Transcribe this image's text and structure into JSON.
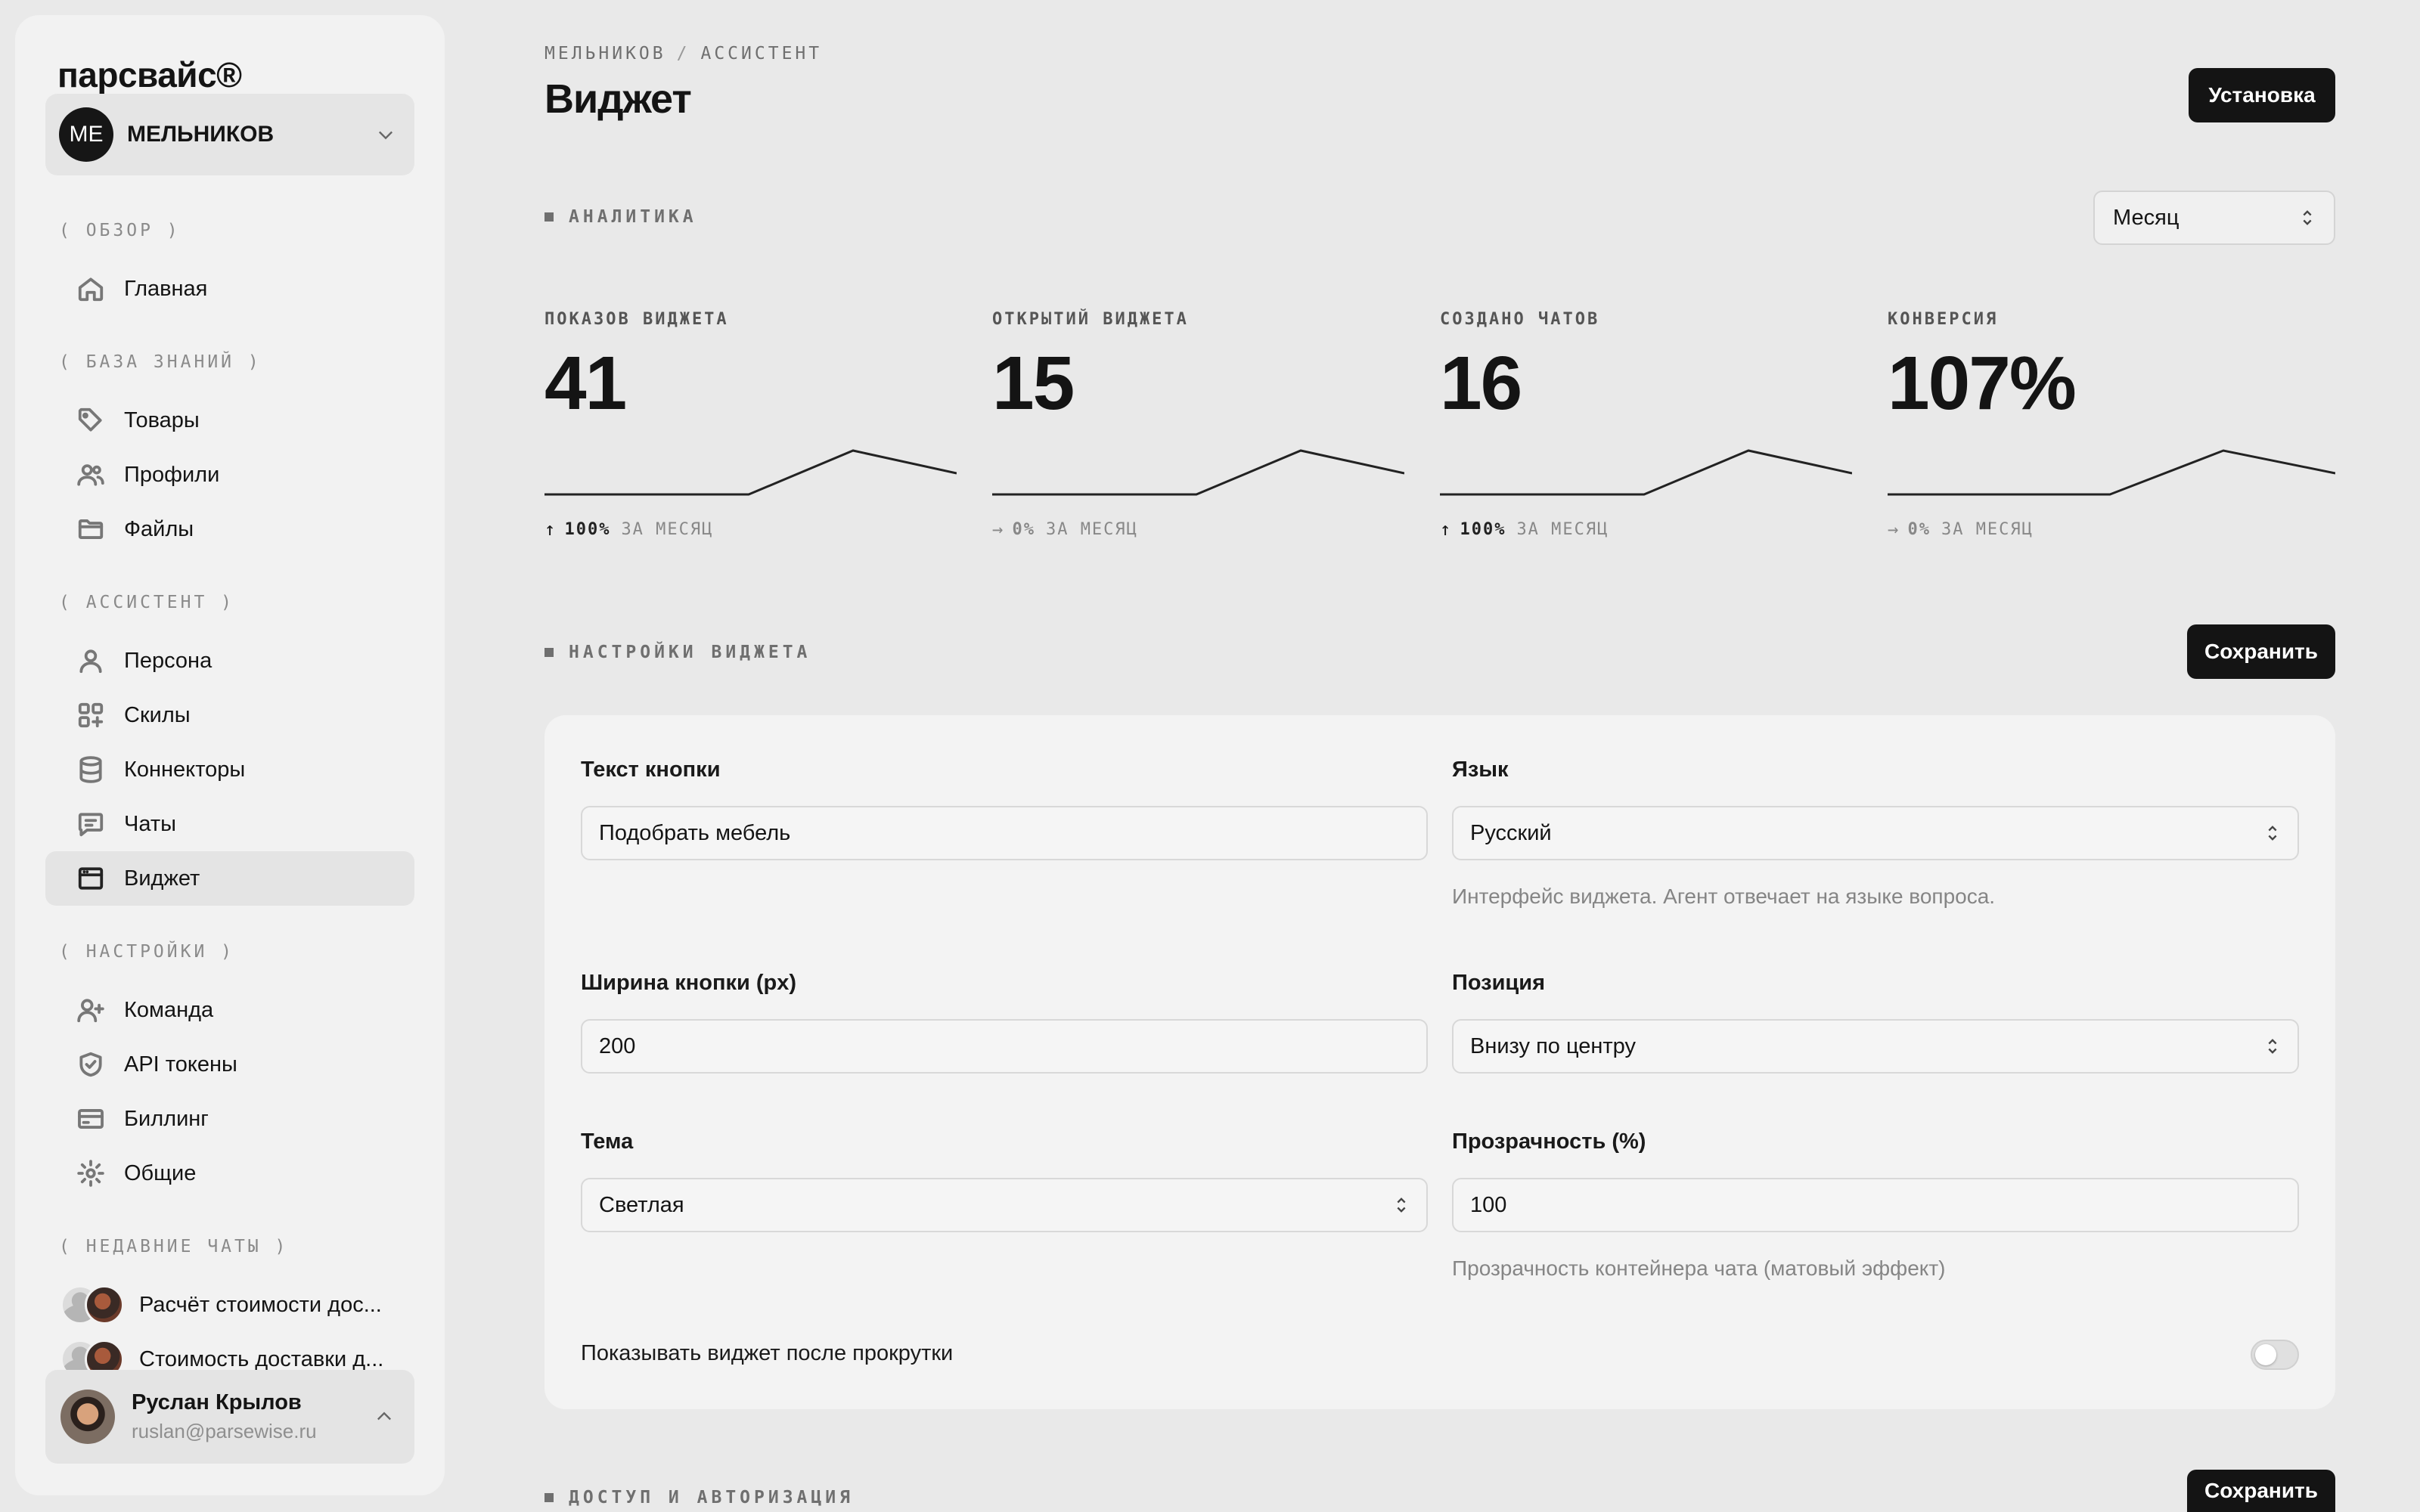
{
  "app": {
    "logo": "парсвайс®"
  },
  "org": {
    "initials": "МЕ",
    "name": "МЕЛЬНИКОВ"
  },
  "sidebar": {
    "sections": [
      {
        "label": "( ОБЗОР )",
        "items": [
          {
            "label": "Главная",
            "icon": "home-icon"
          }
        ]
      },
      {
        "label": "( БАЗА ЗНАНИЙ )",
        "items": [
          {
            "label": "Товары",
            "icon": "tag-icon"
          },
          {
            "label": "Профили",
            "icon": "users-icon"
          },
          {
            "label": "Файлы",
            "icon": "folder-icon"
          }
        ]
      },
      {
        "label": "( АССИСТЕНТ )",
        "items": [
          {
            "label": "Персона",
            "icon": "user-icon"
          },
          {
            "label": "Скилы",
            "icon": "grid-plus-icon"
          },
          {
            "label": "Коннекторы",
            "icon": "database-icon"
          },
          {
            "label": "Чаты",
            "icon": "chat-icon"
          },
          {
            "label": "Виджет",
            "icon": "browser-window-icon",
            "active": true
          }
        ]
      },
      {
        "label": "( НАСТРОЙКИ )",
        "items": [
          {
            "label": "Команда",
            "icon": "user-plus-icon"
          },
          {
            "label": "API токены",
            "icon": "shield-check-icon"
          },
          {
            "label": "Биллинг",
            "icon": "credit-card-icon"
          },
          {
            "label": "Общие",
            "icon": "gear-icon"
          }
        ]
      },
      {
        "label": "( НЕДАВНИЕ ЧАТЫ )",
        "items": []
      }
    ],
    "recent_chats": [
      {
        "title": "Расчёт стоимости дос..."
      },
      {
        "title": "Стоимость доставки д..."
      }
    ],
    "user": {
      "name": "Руслан Крылов",
      "email": "ruslan@parsewise.ru"
    }
  },
  "header": {
    "breadcrumb": [
      "МЕЛЬНИКОВ",
      "АССИСТЕНТ"
    ],
    "breadcrumb_sep": "/",
    "title": "Виджет",
    "install_label": "Установка"
  },
  "analytics": {
    "heading": "АНАЛИТИКА",
    "period": "Месяц",
    "stats": [
      {
        "label": "ПОКАЗОВ ВИДЖЕТА",
        "value": "41",
        "arrow": "↑",
        "change": "100%",
        "period": "ЗА МЕСЯЦ",
        "trend": "up"
      },
      {
        "label": "ОТКРЫТИЙ ВИДЖЕТА",
        "value": "15",
        "arrow": "→",
        "change": "0%",
        "period": "ЗА МЕСЯЦ",
        "trend": "flat"
      },
      {
        "label": "СОЗДАНО ЧАТОВ",
        "value": "16",
        "arrow": "↑",
        "change": "100%",
        "period": "ЗА МЕСЯЦ",
        "trend": "up"
      },
      {
        "label": "КОНВЕРСИЯ",
        "value": "107%",
        "arrow": "→",
        "change": "0%",
        "period": "ЗА МЕСЯЦ",
        "trend": "flat"
      }
    ]
  },
  "widget_settings": {
    "heading": "НАСТРОЙКИ ВИДЖЕТА",
    "save_label": "Сохранить",
    "button_text": {
      "label": "Текст кнопки",
      "value": "Подобрать мебель"
    },
    "language": {
      "label": "Язык",
      "value": "Русский",
      "hint": "Интерфейс виджета. Агент отвечает на языке вопроса."
    },
    "button_width": {
      "label": "Ширина кнопки (px)",
      "value": "200"
    },
    "position": {
      "label": "Позиция",
      "value": "Внизу по центру"
    },
    "theme": {
      "label": "Тема",
      "value": "Светлая"
    },
    "opacity": {
      "label": "Прозрачность (%)",
      "value": "100",
      "hint": "Прозрачность контейнера чата (матовый эффект)"
    },
    "show_after_scroll": {
      "label": "Показывать виджет после прокрутки",
      "enabled": false
    }
  },
  "access": {
    "heading": "ДОСТУП И АВТОРИЗАЦИЯ",
    "save_label": "Сохранить"
  }
}
